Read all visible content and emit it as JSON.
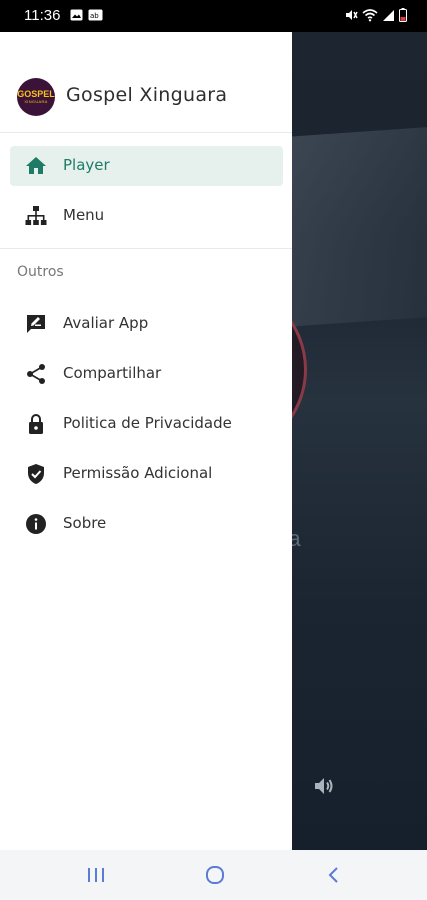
{
  "status_bar": {
    "time": "11:36",
    "left_icons": [
      "image-icon",
      "message-icon"
    ],
    "right_icons": [
      "mute-icon",
      "wifi-icon",
      "signal-icon",
      "battery-icon"
    ]
  },
  "drawer": {
    "header": {
      "logo_text_top": "GOSPEL",
      "logo_text_bottom": "XINGUARA",
      "title": "Gospel Xinguara"
    },
    "main_items": [
      {
        "label": "Player",
        "icon": "home-icon",
        "active": true
      },
      {
        "label": "Menu",
        "icon": "sitemap-icon",
        "active": false
      }
    ],
    "section_title": "Outros",
    "other_items": [
      {
        "label": "Avaliar App",
        "icon": "rate-icon"
      },
      {
        "label": "Compartilhar",
        "icon": "share-icon"
      },
      {
        "label": "Politica de Privacidade",
        "icon": "lock-icon"
      },
      {
        "label": "Permissão Adicional",
        "icon": "shield-check-icon"
      },
      {
        "label": "Sobre",
        "icon": "info-icon"
      }
    ],
    "accent_color": "#1f7a66",
    "active_bg": "#e6f1ee"
  },
  "background": {
    "partial_text": "ra"
  },
  "nav_bar": {
    "buttons": [
      "recent-apps-icon",
      "home-circle-icon",
      "back-icon"
    ]
  }
}
